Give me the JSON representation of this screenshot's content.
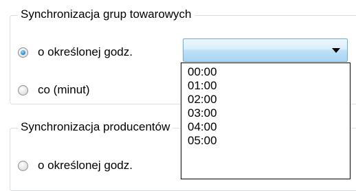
{
  "group1": {
    "legend": "Synchronizacja grup towarowych",
    "option_specific_time": "o określonej godz.",
    "option_interval": "co (minut)",
    "selected": "option_specific_time"
  },
  "group2": {
    "legend": "Synchronizacja producentów",
    "option_specific_time": "o określonej godz."
  },
  "combo": {
    "value": "",
    "arrow_icon": "chevron-down-icon"
  },
  "dropdown": {
    "items": [
      "00:00",
      "01:00",
      "02:00",
      "03:00",
      "04:00",
      "05:00"
    ]
  }
}
